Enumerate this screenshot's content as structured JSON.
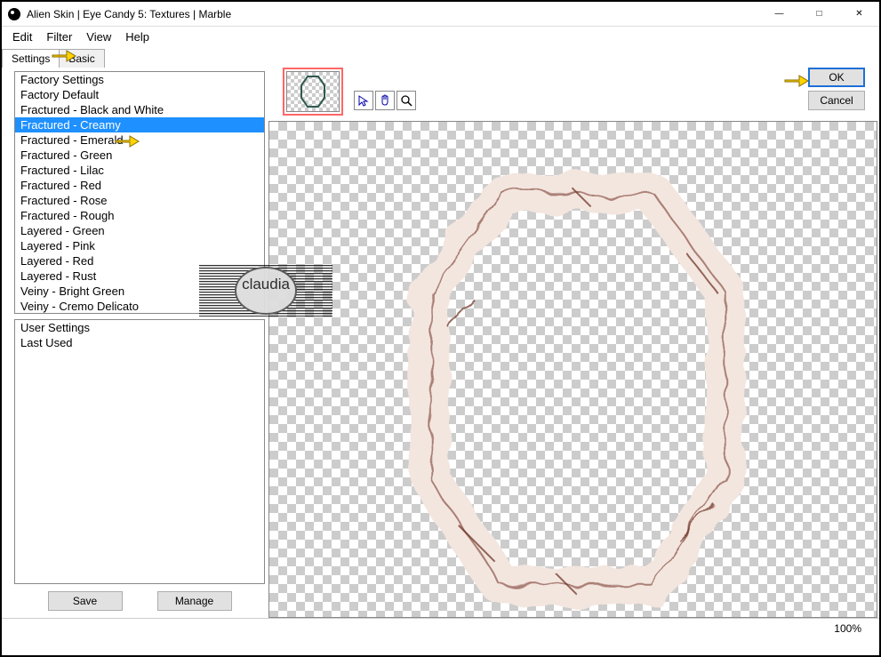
{
  "window": {
    "title": "Alien Skin | Eye Candy 5: Textures | Marble"
  },
  "menubar": {
    "items": [
      "Edit",
      "Filter",
      "View",
      "Help"
    ]
  },
  "tabs": {
    "items": [
      "Settings",
      "Basic"
    ],
    "active_index": 0
  },
  "buttons": {
    "ok": "OK",
    "cancel": "Cancel",
    "save": "Save",
    "manage": "Manage"
  },
  "factory_list": {
    "header": "Factory Settings",
    "items": [
      "Factory Default",
      "Fractured - Black and White",
      "Fractured - Creamy",
      "Fractured - Emerald",
      "Fractured - Green",
      "Fractured - Lilac",
      "Fractured - Red",
      "Fractured - Rose",
      "Fractured - Rough",
      "Layered - Green",
      "Layered - Pink",
      "Layered - Red",
      "Layered - Rust",
      "Veiny - Bright Green",
      "Veiny - Cremo Delicato"
    ],
    "selected_index": 2
  },
  "user_list": {
    "items": [
      "User Settings",
      "Last Used"
    ]
  },
  "status": {
    "zoom": "100%"
  },
  "watermark": {
    "text": "claudia"
  }
}
